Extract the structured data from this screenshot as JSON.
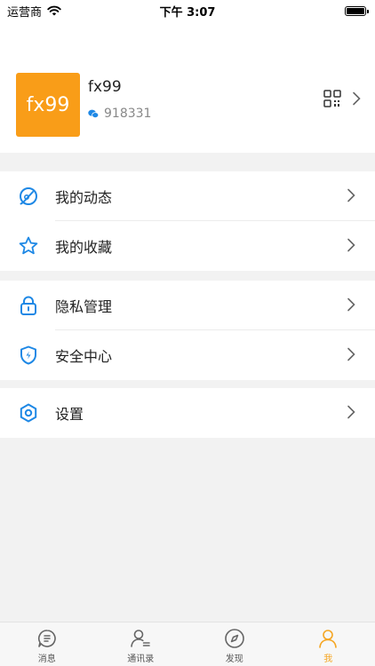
{
  "status_bar": {
    "carrier": "运营商",
    "time": "下午 3:07"
  },
  "profile": {
    "avatar_text": "fx99",
    "name": "fx99",
    "id": "918331"
  },
  "menu": {
    "moments": "我的动态",
    "favorites": "我的收藏",
    "privacy": "隐私管理",
    "security": "安全中心",
    "settings": "设置"
  },
  "tabs": {
    "messages": "消息",
    "contacts": "通讯录",
    "discover": "发现",
    "me": "我"
  },
  "colors": {
    "accent": "#1e88e5",
    "active_tab": "#f5a623",
    "avatar_bg": "#f99d18"
  }
}
